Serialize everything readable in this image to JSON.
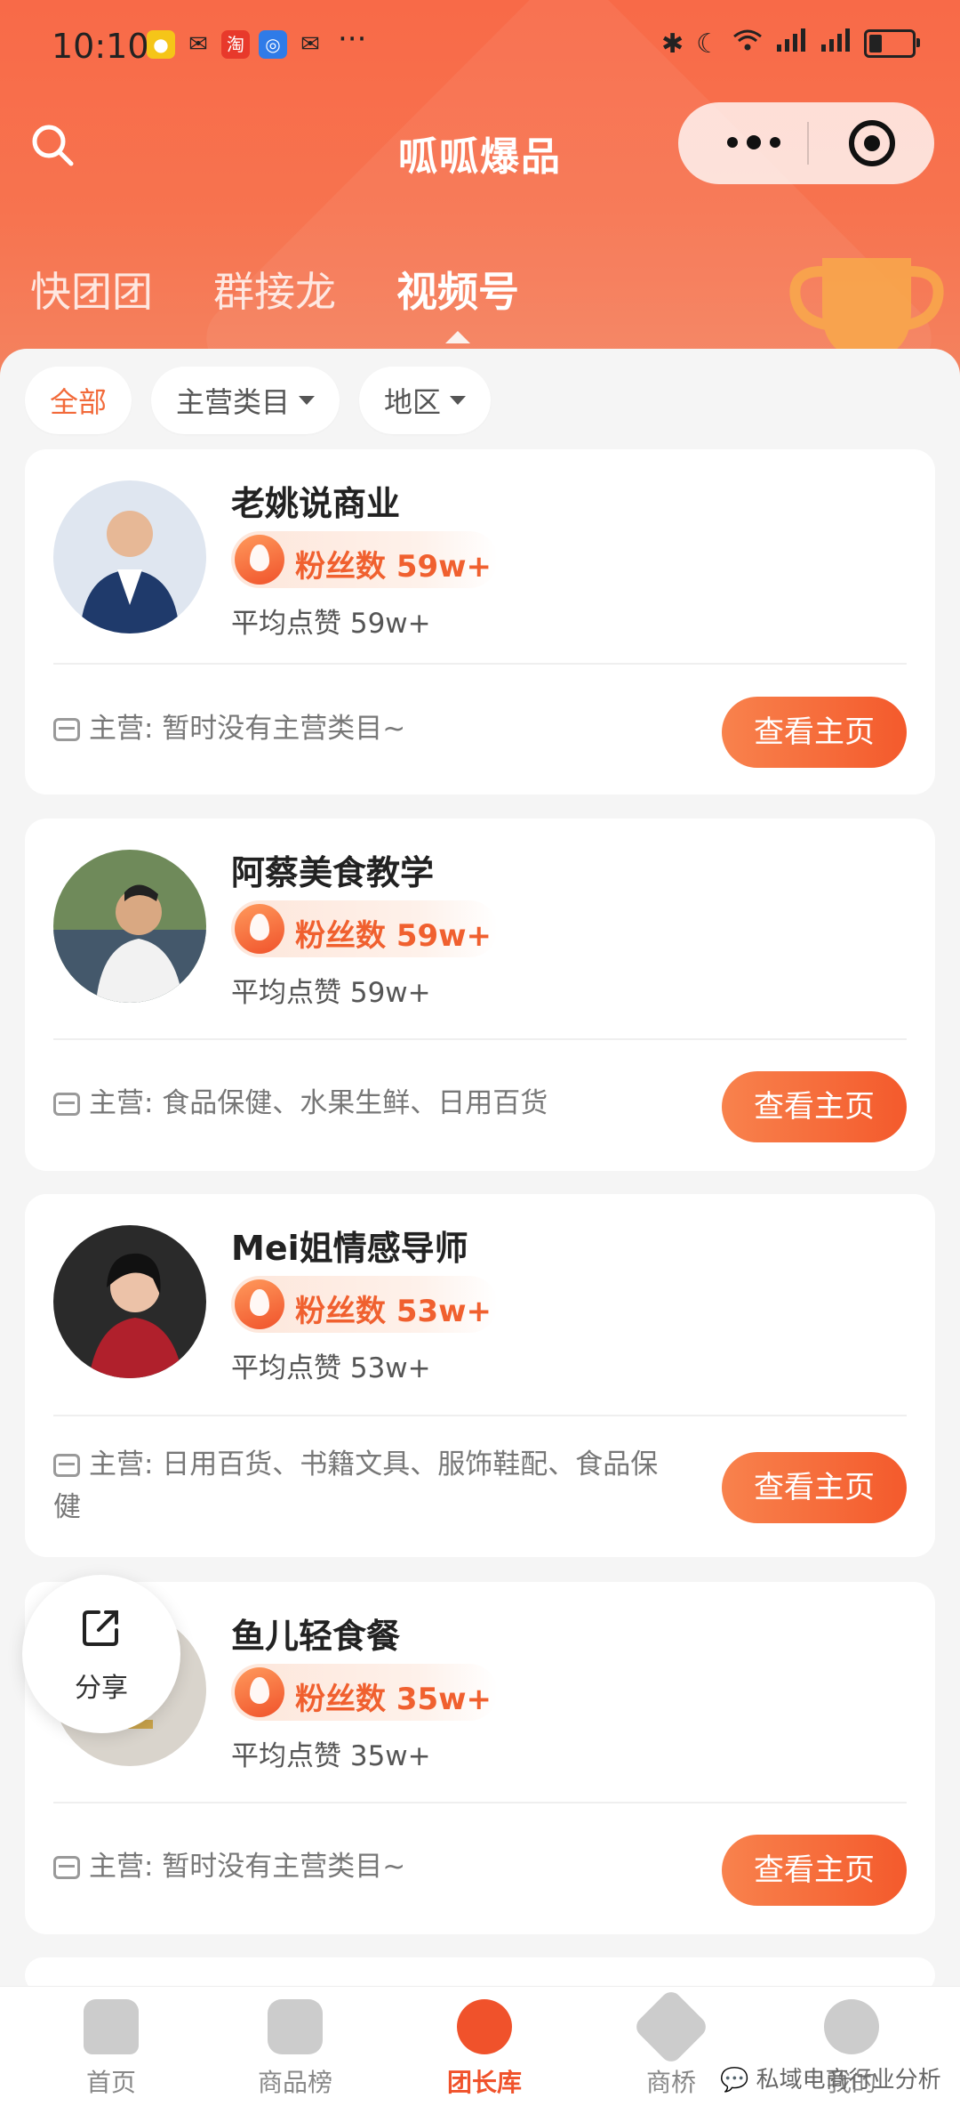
{
  "status_bar": {
    "time": "10:10",
    "app_icons": [
      "weibo-icon",
      "wechat-icon",
      "taobao-icon",
      "browser-icon",
      "wechat-icon"
    ],
    "more": "···"
  },
  "header": {
    "title": "呱呱爆品"
  },
  "tabs": [
    {
      "label": "快团团",
      "active": false
    },
    {
      "label": "群接龙",
      "active": false
    },
    {
      "label": "视频号",
      "active": true
    }
  ],
  "filters": [
    {
      "label": "全部",
      "active": true
    },
    {
      "label": "主营类目",
      "dropdown": true
    },
    {
      "label": "地区",
      "dropdown": true
    }
  ],
  "cards": [
    {
      "name": "老姚说商业",
      "fans": "粉丝数 59w+",
      "likes": "平均点赞 59w+",
      "category": "主营:  暂时没有主营类目~",
      "button": "查看主页"
    },
    {
      "name": "阿蔡美食教学",
      "fans": "粉丝数 59w+",
      "likes": "平均点赞 59w+",
      "category": "主营:  食品保健、水果生鲜、日用百货",
      "button": "查看主页"
    },
    {
      "name": "Mei姐情感导师",
      "fans": "粉丝数 53w+",
      "likes": "平均点赞 53w+",
      "category": "主营:  日用百货、书籍文具、服饰鞋配、食品保健",
      "button": "查看主页"
    },
    {
      "name": "鱼儿轻食餐",
      "fans": "粉丝数 35w+",
      "likes": "平均点赞 35w+",
      "category": "主营:  暂时没有主营类目~",
      "button": "查看主页"
    }
  ],
  "share": {
    "label": "分享"
  },
  "bottom_nav": [
    {
      "label": "首页",
      "icon": "home-icon"
    },
    {
      "label": "商品榜",
      "icon": "shopping-bag-icon"
    },
    {
      "label": "团长库",
      "icon": "leader-library-icon",
      "active": true
    },
    {
      "label": "商桥",
      "icon": "handshake-icon"
    },
    {
      "label": "我的",
      "icon": "profile-icon"
    }
  ],
  "watermark": "私域电商行业分析",
  "colors": {
    "brand": "#f7704d",
    "accent": "#f0522b",
    "button_start": "#f8824d",
    "button_end": "#f45a2c"
  }
}
